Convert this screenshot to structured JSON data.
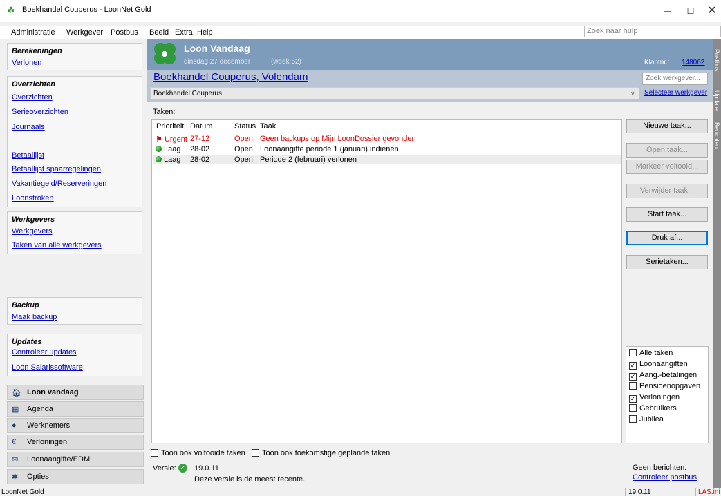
{
  "window": {
    "title": "Boekhandel Couperus - LoonNet Gold"
  },
  "menu": {
    "items": [
      "Administratie",
      "Werkgever",
      "Postbus",
      "Beeld",
      "Extra",
      "Help"
    ],
    "help_placeholder": "Zoek naar hulp"
  },
  "sidebar": {
    "berekeningen": {
      "title": "Berekeningen",
      "links": [
        "Verlonen"
      ]
    },
    "overzichten": {
      "title": "Overzichten",
      "links": [
        "Overzichten",
        "Serieoverzichten",
        "Journaals",
        "Betaallijst",
        "Betaallijst spaarregelingen",
        "Vakantiegeld/Reserveringen",
        "Loonstroken"
      ]
    },
    "werkgevers": {
      "title": "Werkgevers",
      "links": [
        "Werkgevers",
        "Taken van alle werkgevers"
      ]
    },
    "backup": {
      "title": "Backup",
      "links": [
        "Maak backup"
      ]
    },
    "updates": {
      "title": "Updates",
      "links": [
        "Controleer updates",
        "Loon Salarissoftware"
      ]
    },
    "nav": [
      "Loon vandaag",
      "Agenda",
      "Werknemers",
      "Verloningen",
      "Loonaangifte/EDM",
      "Opties"
    ]
  },
  "header": {
    "title": "Loon Vandaag",
    "date": "dinsdag 27 december",
    "week": "(week 52)",
    "klantnr_label": "Klantnr.:",
    "klantnr": "148062",
    "company_link": "Boekhandel Couperus, Volendam",
    "search_placeholder": "Zoek werkgever...",
    "company_select": "Boekhandel Couperus",
    "select_link": "Selecteer werkgever"
  },
  "right_tabs": [
    "Postbus",
    "Update",
    "Berichten"
  ],
  "tasks": {
    "label": "Taken:",
    "columns": [
      "Prioriteit",
      "Datum",
      "Status",
      "Taak"
    ],
    "rows": [
      {
        "priority": "Urgent",
        "date": "27-12",
        "status": "Open",
        "task": "Geen backups op Mijn LoonDossier gevonden",
        "urgent": true
      },
      {
        "priority": "Laag",
        "date": "28-02",
        "status": "Open",
        "task": "Loonaangifte periode 1 (januari) indienen",
        "urgent": false
      },
      {
        "priority": "Laag",
        "date": "28-02",
        "status": "Open",
        "task": "Periode 2 (februari) verlonen",
        "urgent": false
      }
    ]
  },
  "buttons": {
    "nieuwe": "Nieuwe taak...",
    "open": "Open taak...",
    "markeer": "Markeer voltooid...",
    "verwijder": "Verwijder taak...",
    "start": "Start taak...",
    "druk": "Druk af...",
    "serie": "Serietaken..."
  },
  "filters": [
    {
      "label": "Alle taken",
      "checked": false
    },
    {
      "label": "Loonaangiften",
      "checked": true
    },
    {
      "label": "Aang.-betalingen",
      "checked": true
    },
    {
      "label": "Pensioenopgaven",
      "checked": false
    },
    {
      "label": "Verloningen",
      "checked": true
    },
    {
      "label": "Gebruikers",
      "checked": false
    },
    {
      "label": "Jubilea",
      "checked": false
    }
  ],
  "bottom": {
    "toon_voltooid": "Toon ook voltooide taken",
    "toon_toekomstig": "Toon ook toekomstige geplande taken",
    "versie_label": "Versie:",
    "versie": "19.0.11",
    "versie_msg": "Deze versie is de meest recente.",
    "geen_berichten": "Geen berichten.",
    "controleer_postbus": "Controleer postbus"
  },
  "statusbar": {
    "left": "LoonNet Gold",
    "version": "19.0.11",
    "ini": "LAS.ini"
  }
}
